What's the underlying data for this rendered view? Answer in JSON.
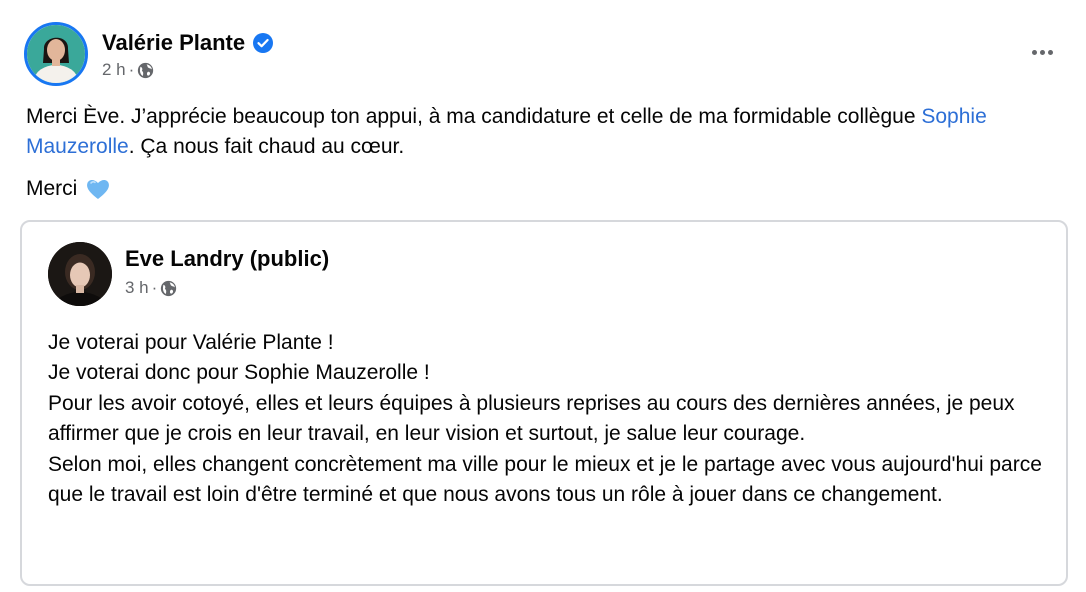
{
  "post": {
    "author": "Valérie Plante",
    "time": "2 h",
    "separator": "·",
    "text_part1": "Merci Ève. J’apprécie beaucoup ton appui, à ma candidature et celle de ma formidable collègue ",
    "mention": "Sophie Mauzerolle",
    "text_part2": ". Ça nous fait chaud au cœur.",
    "merci": "Merci",
    "icons": {
      "verified": "verified-badge-icon",
      "privacy": "globe-icon",
      "menu": "more-options-icon",
      "emoji": "blue-heart-icon"
    }
  },
  "shared_post": {
    "author": "Eve Landry (public)",
    "time": "3 h",
    "separator": "·",
    "lines": [
      "Je voterai pour Valérie Plante !",
      "Je voterai donc pour Sophie Mauzerolle !",
      "Pour les avoir cotoyé, elles et leurs équipes à plusieurs reprises au cours des dernières années, je peux affirmer que je crois en leur travail, en leur vision et surtout, je salue leur courage.",
      "Selon moi, elles changent concrètement ma ville pour le mieux et je le partage avec vous aujourd'hui parce que le travail est loin d'être terminé et que nous avons tous un rôle à jouer dans ce changement."
    ]
  },
  "colors": {
    "accent": "#1877f2",
    "mention": "#2d6fd6",
    "meta_text": "#65676b",
    "border": "#d6d8dc",
    "heart": "#6fb7f2"
  }
}
